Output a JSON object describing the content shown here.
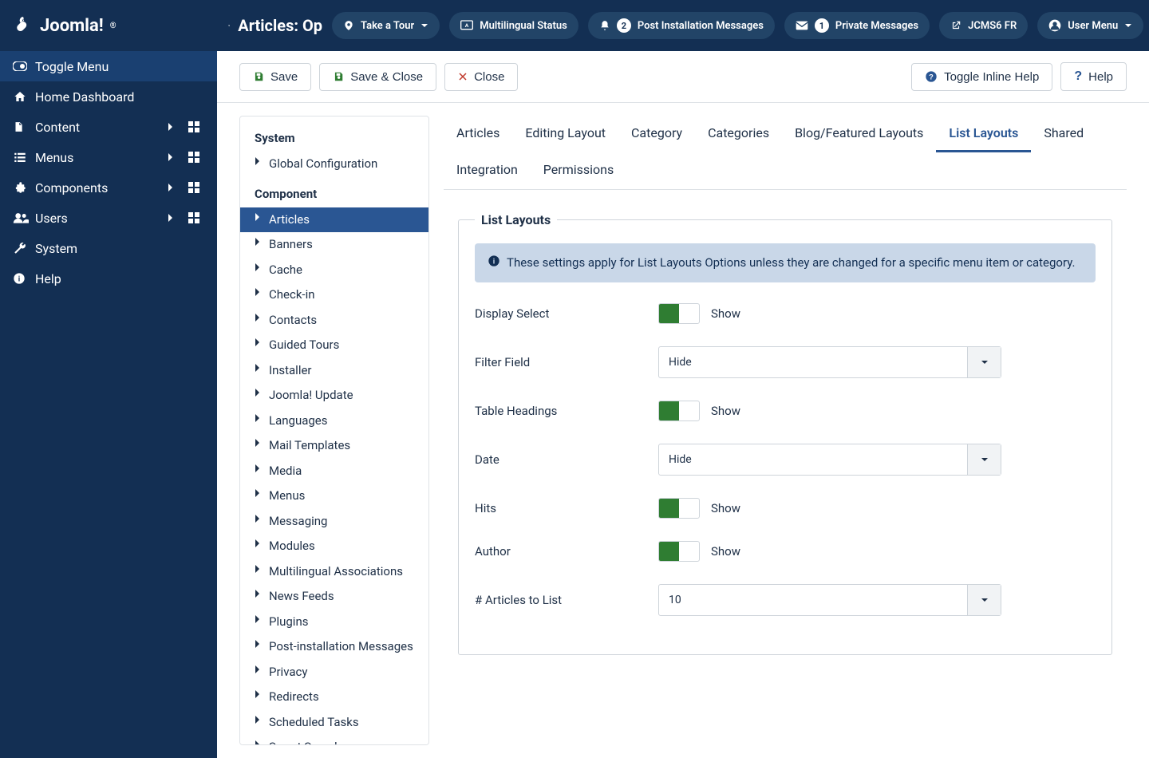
{
  "brand": "Joomla!",
  "page_title_prefix": "Articles: Op",
  "topbar": {
    "tour": "Take a Tour",
    "multilingual": "Multilingual Status",
    "post_install": "Post Installation Messages",
    "post_install_badge": "2",
    "private_msg": "Private Messages",
    "private_msg_badge": "1",
    "site": "JCMS6 FR",
    "user_menu": "User Menu"
  },
  "sidebar": {
    "toggle": "Toggle Menu",
    "items": [
      {
        "label": "Home Dashboard",
        "icon": "home"
      },
      {
        "label": "Content",
        "icon": "file",
        "expand": true,
        "grid": true
      },
      {
        "label": "Menus",
        "icon": "list",
        "expand": true,
        "grid": true
      },
      {
        "label": "Components",
        "icon": "puzzle",
        "expand": true,
        "grid": true
      },
      {
        "label": "Users",
        "icon": "users",
        "expand": true,
        "grid": true
      },
      {
        "label": "System",
        "icon": "wrench"
      },
      {
        "label": "Help",
        "icon": "info"
      }
    ]
  },
  "toolbar": {
    "save": "Save",
    "save_close": "Save & Close",
    "close": "Close",
    "toggle_help": "Toggle Inline Help",
    "help": "Help"
  },
  "side_panel": {
    "system_header": "System",
    "global": "Global Configuration",
    "component_header": "Component",
    "components": [
      "Articles",
      "Banners",
      "Cache",
      "Check-in",
      "Contacts",
      "Guided Tours",
      "Installer",
      "Joomla! Update",
      "Languages",
      "Mail Templates",
      "Media",
      "Menus",
      "Messaging",
      "Modules",
      "Multilingual Associations",
      "News Feeds",
      "Plugins",
      "Post-installation Messages",
      "Privacy",
      "Redirects",
      "Scheduled Tasks",
      "Smart Search"
    ],
    "active_index": 0
  },
  "tabs": [
    "Articles",
    "Editing Layout",
    "Category",
    "Categories",
    "Blog/Featured Layouts",
    "List Layouts",
    "Shared",
    "Integration",
    "Permissions"
  ],
  "active_tab": 5,
  "fieldset": {
    "legend": "List Layouts",
    "info": "These settings apply for List Layouts Options unless they are changed for a specific menu item or category.",
    "rows": [
      {
        "label": "Display Select",
        "type": "switch",
        "value": "Show"
      },
      {
        "label": "Filter Field",
        "type": "select",
        "value": "Hide"
      },
      {
        "label": "Table Headings",
        "type": "switch",
        "value": "Show"
      },
      {
        "label": "Date",
        "type": "select",
        "value": "Hide"
      },
      {
        "label": "Hits",
        "type": "switch",
        "value": "Show"
      },
      {
        "label": "Author",
        "type": "switch",
        "value": "Show"
      },
      {
        "label": "# Articles to List",
        "type": "select",
        "value": "10"
      }
    ]
  }
}
